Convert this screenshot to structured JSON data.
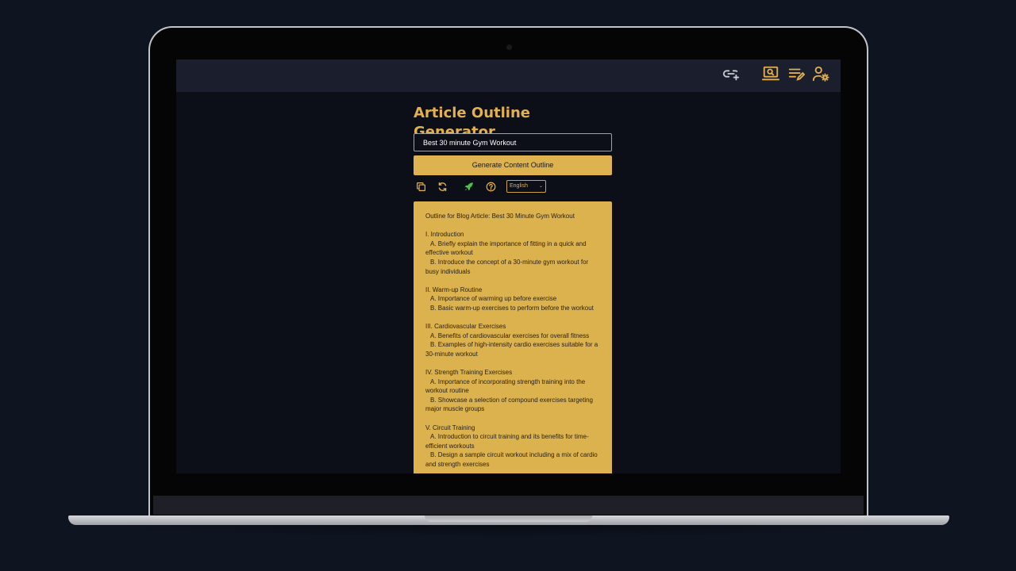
{
  "app": {
    "title": "Article Outline Generator",
    "topic_input_value": "Best 30 minute Gym Workout",
    "generate_button_label": "Generate Content Outline",
    "language_selected": "English"
  },
  "topbar": {
    "icons": [
      "link-add-icon",
      "laptop-search-icon",
      "edit-list-icon",
      "user-settings-icon"
    ]
  },
  "toolbar": {
    "icons": [
      "copy-icon",
      "refresh-icon",
      "rocket-icon",
      "help-icon"
    ]
  },
  "colors": {
    "accent": "#e3b04b",
    "panel": "#dcb24f",
    "background": "#0c0f18",
    "topbar": "#1b1f2d",
    "rocket": "#4fc14a"
  },
  "outline": {
    "heading": "Outline for Blog Article: Best 30 Minute Gym Workout",
    "sections": [
      {
        "title": "I. Introduction",
        "items": [
          "A. Briefly explain the importance of fitting in a quick and effective workout",
          "B. Introduce the concept of a 30-minute gym workout for busy individuals"
        ]
      },
      {
        "title": "II. Warm-up Routine",
        "items": [
          "A. Importance of warming up before exercise",
          "B. Basic warm-up exercises to perform before the workout"
        ]
      },
      {
        "title": "III. Cardiovascular Exercises",
        "items": [
          "A. Benefits of cardiovascular exercises for overall fitness",
          "B. Examples of high-intensity cardio exercises suitable for a 30-minute workout"
        ]
      },
      {
        "title": "IV. Strength Training Exercises",
        "items": [
          "A. Importance of incorporating strength training into the workout routine",
          "B. Showcase a selection of compound exercises targeting major muscle groups"
        ]
      },
      {
        "title": "V. Circuit Training",
        "items": [
          "A. Introduction to circuit training and its benefits for time-efficient workouts",
          "B. Design a sample circuit workout including a mix of cardio and strength exercises"
        ]
      }
    ]
  }
}
